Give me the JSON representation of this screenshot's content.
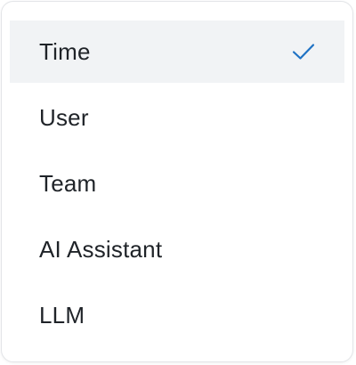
{
  "menu": {
    "options": [
      {
        "label": "Time",
        "selected": true
      },
      {
        "label": "User",
        "selected": false
      },
      {
        "label": "Team",
        "selected": false
      },
      {
        "label": "AI Assistant",
        "selected": false
      },
      {
        "label": "LLM",
        "selected": false
      }
    ],
    "check_icon": "checkmark-icon",
    "colors": {
      "accent": "#1f72c4",
      "selected_background": "#f1f3f5",
      "text": "#1f2328",
      "border": "#e3e5e8"
    }
  }
}
